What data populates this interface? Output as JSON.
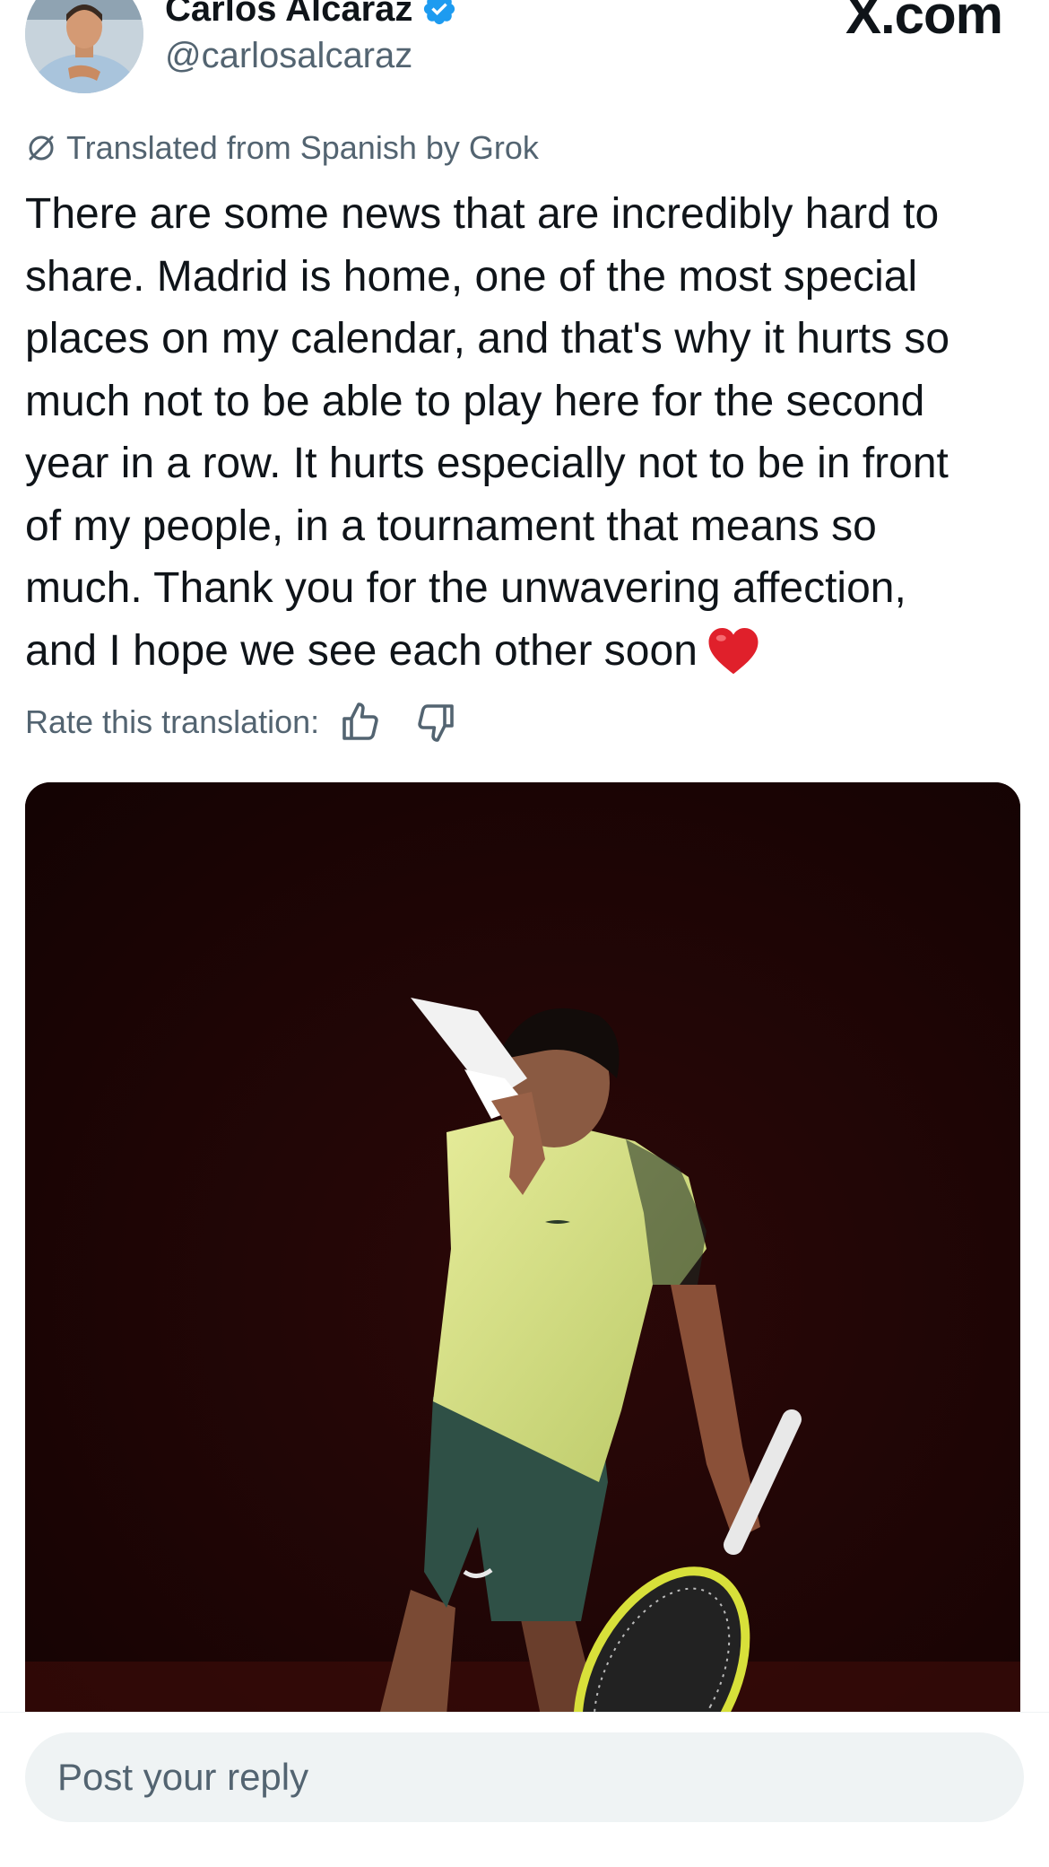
{
  "author": {
    "name": "Carlos Alcaraz",
    "handle": "@carlosalcaraz",
    "verified": true
  },
  "watermark": "X.com",
  "translation": {
    "label": "Translated from Spanish by Grok",
    "text": "There are some news that are incredibly hard to\nshare. Madrid is home, one of the most special\nplaces on my calendar, and that's why it hurts so\nmuch not to be able to play here for the second\nyear in a row. It hurts especially not to be in front\nof my people, in a tournament that means so\nmuch. Thank you for the unwavering affection,\nand I hope we see each other soon",
    "emoji": "red-heart",
    "rate_label": "Rate this translation:"
  },
  "reply": {
    "placeholder": "Post your reply"
  },
  "colors": {
    "text": "#0f1419",
    "secondary": "#536471",
    "verified": "#1d9bf0",
    "reply_bg": "#eff3f4",
    "heart": "#e0202b"
  },
  "icons": [
    "verified-badge-icon",
    "translate-icon",
    "heart-emoji-icon",
    "thumbs-up-icon",
    "thumbs-down-icon"
  ]
}
